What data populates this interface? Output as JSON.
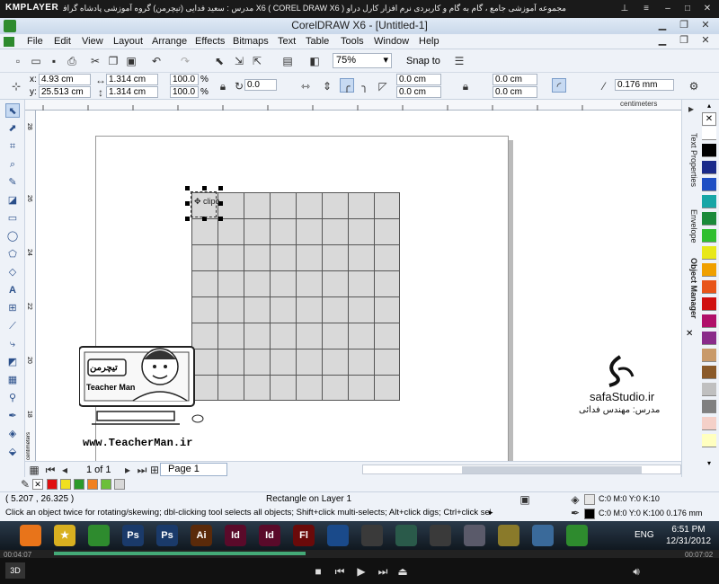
{
  "kmplayer": {
    "logo": "KMPLAYER",
    "title": "مجموعه آموزشی جامع ، گام به گام و کاربردی نرم افزار کارل دراو X6 ( COREL DRAW X6 )  مدرس : سعید فدایی (تیچرمن) گروه آموزشی پادشاه گرافیست ها",
    "elapsed": "00:04:07",
    "total": "00:07:02"
  },
  "corel": {
    "title": "CorelDRAW X6 - [Untitled-1]"
  },
  "menu": [
    {
      "label": "File"
    },
    {
      "label": "Edit"
    },
    {
      "label": "View"
    },
    {
      "label": "Layout"
    },
    {
      "label": "Arrange"
    },
    {
      "label": "Effects"
    },
    {
      "label": "Bitmaps"
    },
    {
      "label": "Text"
    },
    {
      "label": "Table"
    },
    {
      "label": "Tools"
    },
    {
      "label": "Window"
    },
    {
      "label": "Help"
    }
  ],
  "toolbar": {
    "zoom": "75%",
    "snap_to": "Snap to"
  },
  "property_bar": {
    "x_label": "x:",
    "x_value": "4.93 cm",
    "y_label": "y:",
    "y_value": "25.513 cm",
    "w_value": "1.314 cm",
    "h_value": "1.314 cm",
    "scale_w": "100.0",
    "scale_h": "100.0",
    "percent": "%",
    "rotation": "0.0",
    "corner1": "0.0 cm",
    "corner2": "0.0 cm",
    "corner3": "0.0 cm",
    "corner4": "0.0 cm",
    "outline": "0.176 mm"
  },
  "ruler": {
    "unit": "centimeters",
    "left_unit": "centimeters",
    "left_ticks": [
      "28",
      "26",
      "24",
      "22",
      "20",
      "18"
    ]
  },
  "canvas": {
    "selection_label": "clipo",
    "teacherman_url": "www.TeacherMan.ir",
    "teacherman_name": "Teacher Man",
    "teacherman_logo_fa": "تیچرمن",
    "safa_site": "safaStudio.ir",
    "safa_sub": "مدرس: مهندس فدائی"
  },
  "dockers": {
    "tabs": [
      "Text Properties",
      "Envelope",
      "Object Manager"
    ]
  },
  "palette_colors": [
    "#ffffff",
    "#000000",
    "#1a2a8a",
    "#1e4fc4",
    "#17a6a6",
    "#1a8a3a",
    "#2fbf2f",
    "#e8e81a",
    "#f0a000",
    "#e8551a",
    "#d01010",
    "#b0106a",
    "#8a2b8a",
    "#c99a6a",
    "#8a5a2a",
    "#c0c0c0",
    "#808080",
    "#f4d0c8",
    "#ffffc0"
  ],
  "doc_palette": [
    "#e01010",
    "#f0e020",
    "#2a9a2a",
    "#f08020",
    "#6cbf3a",
    "#d8d8d8"
  ],
  "page_nav": {
    "count": "1 of 1",
    "page_tab": "Page 1"
  },
  "status": {
    "coords": "( 5.207 , 26.325 )",
    "object_info": "Rectangle on Layer 1",
    "fill_info": "C:0 M:0 Y:0 K:10",
    "outline_info": "C:0 M:0 Y:0 K:100  0.176 mm",
    "hint": "Click an object twice for rotating/skewing; dbl-clicking tool selects all objects; Shift+click multi-selects; Alt+click digs; Ctrl+click selects in a group"
  },
  "taskbar": {
    "apps": [
      {
        "label": "",
        "color": "#e8741a"
      },
      {
        "label": "★",
        "color": "#d8b020"
      },
      {
        "label": "",
        "color": "#2e8b2e"
      },
      {
        "label": "Ps",
        "color": "#1a3a6a"
      },
      {
        "label": "Ps",
        "color": "#1a3a6a"
      },
      {
        "label": "Ai",
        "color": "#5a2a0a"
      },
      {
        "label": "Id",
        "color": "#5a0a2a"
      },
      {
        "label": "Id",
        "color": "#5a0a2a"
      },
      {
        "label": "Fl",
        "color": "#6a0a0a"
      },
      {
        "label": "",
        "color": "#1a4a8a"
      },
      {
        "label": "",
        "color": "#3a3a3a"
      },
      {
        "label": "",
        "color": "#2a5a4a"
      },
      {
        "label": "",
        "color": "#3a3a3a"
      },
      {
        "label": "",
        "color": "#5a5a6a"
      },
      {
        "label": "",
        "color": "#8a7a2a"
      },
      {
        "label": "",
        "color": "#3a6a9a"
      },
      {
        "label": "",
        "color": "#2e8b2e"
      }
    ],
    "lang": "ENG",
    "time": "6:51 PM",
    "date": "12/31/2012"
  }
}
